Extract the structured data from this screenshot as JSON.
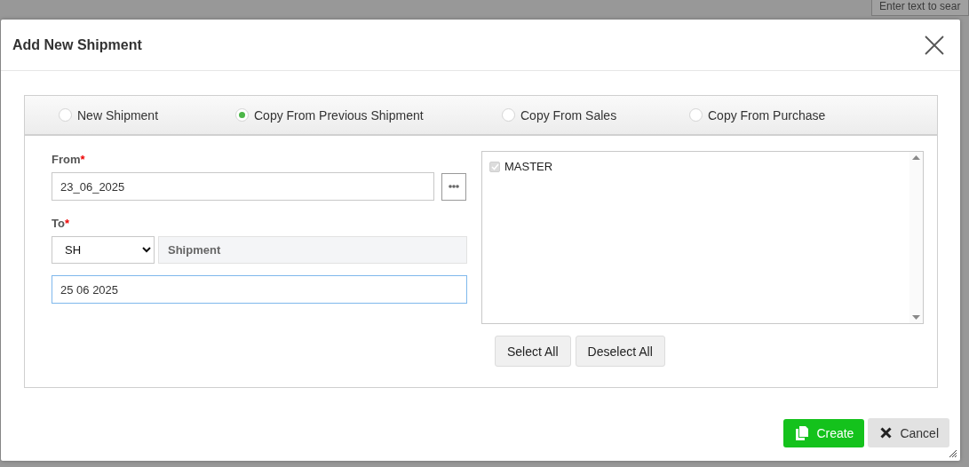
{
  "background": {
    "search_field": {
      "placeholder": "Enter text to sear"
    }
  },
  "dialog": {
    "title": "Add New Shipment",
    "modes": [
      {
        "label": "New Shipment",
        "selected": false
      },
      {
        "label": "Copy From Previous Shipment",
        "selected": true
      },
      {
        "label": "Copy From Sales",
        "selected": false
      },
      {
        "label": "Copy From Purchase",
        "selected": false
      }
    ],
    "from": {
      "label": "From",
      "marker": "*",
      "value": "23_06_2025"
    },
    "to": {
      "label": "To",
      "marker": "*",
      "prefix": "SH",
      "type_name": "Shipment",
      "value": "25 06 2025"
    },
    "items": [
      {
        "label": "MASTER",
        "checked": true,
        "disabled": true
      }
    ],
    "list_buttons": [
      "Select All",
      "Deselect All"
    ],
    "buttons": [
      {
        "label": "Create",
        "kind": "primary"
      },
      {
        "label": "Cancel",
        "kind": "secondary"
      }
    ]
  }
}
